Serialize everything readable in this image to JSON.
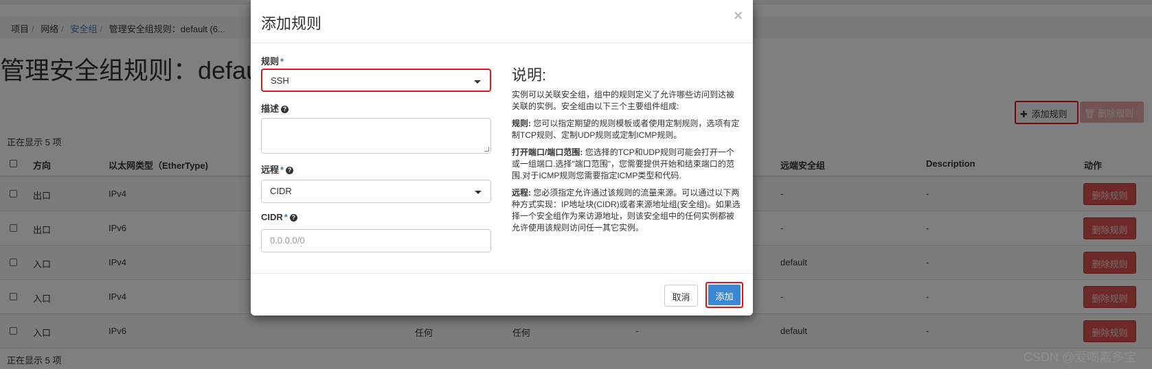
{
  "breadcrumb": {
    "items": [
      "项目",
      "网络",
      "安全组",
      "管理安全组规则：default (6..."
    ]
  },
  "page": {
    "title": "管理安全组规则：default",
    "add_rule_label": "添加规则",
    "delete_rules_label": "删除规则",
    "showing_count": "正在显示 5 项"
  },
  "table": {
    "headers": {
      "direction": "方向",
      "ethertype": "以太网类型（EtherType)",
      "remote_group": "远端安全组",
      "description": "Description",
      "actions": "动作"
    },
    "rows": [
      {
        "direction": "出口",
        "ethertype": "IPv4",
        "ip_protocol": "",
        "port_range": "",
        "remote_ip": "",
        "remote_group": "-",
        "description": "-",
        "action": "删除规则"
      },
      {
        "direction": "出口",
        "ethertype": "IPv6",
        "ip_protocol": "",
        "port_range": "",
        "remote_ip": "",
        "remote_group": "-",
        "description": "-",
        "action": "删除规则"
      },
      {
        "direction": "入口",
        "ethertype": "IPv4",
        "ip_protocol": "",
        "port_range": "",
        "remote_ip": "",
        "remote_group": "default",
        "description": "-",
        "action": "删除规则"
      },
      {
        "direction": "入口",
        "ethertype": "IPv4",
        "ip_protocol": "",
        "port_range": "",
        "remote_ip": "",
        "remote_group": "-",
        "description": "-",
        "action": "删除规则"
      },
      {
        "direction": "入口",
        "ethertype": "IPv6",
        "ip_protocol": "任何",
        "port_range": "任何",
        "remote_ip": "-",
        "remote_group": "default",
        "description": "-",
        "action": "删除规则"
      }
    ]
  },
  "modal": {
    "title": "添加规则",
    "close_glyph": "×",
    "rule_label": "规则",
    "rule_value": "SSH",
    "description_label": "描述",
    "description_value": "",
    "remote_label": "远程",
    "remote_value": "CIDR",
    "cidr_label": "CIDR",
    "cidr_placeholder": "0.0.0.0/0",
    "required_marker": "*",
    "help_glyph": "?",
    "info": {
      "title": "说明:",
      "intro": "实例可以关联安全组，组中的规则定义了允许哪些访问到达被关联的实例。安全组由以下三个主要组件组成:",
      "rule_term": "规则:",
      "rule_text": "您可以指定期望的规则模板或者使用定制规则，选项有定制TCP规则、定制UDP规则或定制ICMP规则。",
      "ports_term": "打开端口/端口范围:",
      "ports_text": "您选择的TCP和UDP规则可能会打开一个或一组端口.选择\"端口范围\"，您需要提供开始和结束端口的范围.对于ICMP规则您需要指定ICMP类型和代码.",
      "remote_term": "远程:",
      "remote_text": "您必须指定允许通过该规则的流量来源。可以通过以下两种方式实现：IP地址块(CIDR)或者来源地址组(安全组)。如果选择一个安全组作为来访源地址，则该安全组中的任何实例都被允许使用该规则访问任一其它实例。"
    },
    "cancel_label": "取消",
    "submit_label": "添加"
  },
  "watermark": "CSDN @爱喝嘉多宝",
  "colors": {
    "highlight": "#e0141c",
    "primary": "#3b88d4",
    "danger": "#d9534f",
    "link": "#337ab7"
  }
}
